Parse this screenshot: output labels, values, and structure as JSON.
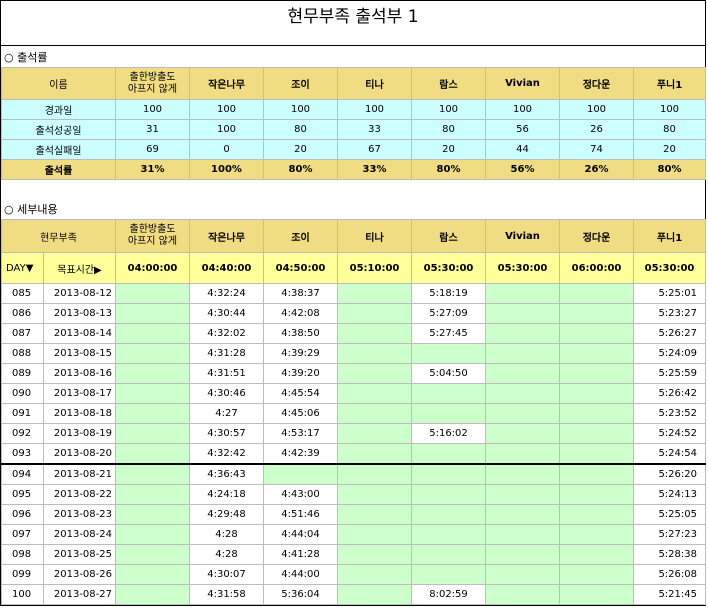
{
  "title": "현무부족 출석부 1",
  "section1": "○ 출석률",
  "section2": "○ 세부내용",
  "members": [
    "출한방출도\n아프지 않게",
    "작은나무",
    "조이",
    "티나",
    "람스",
    "Vivian",
    "정다운",
    "푸니1"
  ],
  "summary": {
    "header_label": "이름",
    "rows": [
      {
        "label": "경과일",
        "values": [
          "100",
          "100",
          "100",
          "100",
          "100",
          "100",
          "100",
          "100"
        ]
      },
      {
        "label": "출석성공일",
        "values": [
          "31",
          "100",
          "80",
          "33",
          "80",
          "56",
          "26",
          "80"
        ]
      },
      {
        "label": "출석실패일",
        "values": [
          "69",
          "0",
          "20",
          "67",
          "20",
          "44",
          "74",
          "20"
        ]
      },
      {
        "label": "출석률",
        "values": [
          "31%",
          "100%",
          "80%",
          "33%",
          "80%",
          "56%",
          "26%",
          "80%"
        ]
      }
    ]
  },
  "detail": {
    "header_label": "현무부족",
    "day_label": "DAY▼",
    "target_label": "목표시간▶",
    "targets": [
      "04:00:00",
      "04:40:00",
      "04:50:00",
      "05:10:00",
      "05:30:00",
      "05:30:00",
      "06:00:00",
      "05:30:00"
    ],
    "rows": [
      {
        "day": "085",
        "date": "2013-08-12",
        "t": [
          "",
          "4:32:24",
          "4:38:37",
          "",
          "5:18:19",
          "",
          "",
          "5:25:01"
        ]
      },
      {
        "day": "086",
        "date": "2013-08-13",
        "t": [
          "",
          "4:30:44",
          "4:42:08",
          "",
          "5:27:09",
          "",
          "",
          "5:23:27"
        ]
      },
      {
        "day": "087",
        "date": "2013-08-14",
        "t": [
          "",
          "4:32:02",
          "4:38:50",
          "",
          "5:27:45",
          "",
          "",
          "5:26:27"
        ]
      },
      {
        "day": "088",
        "date": "2013-08-15",
        "t": [
          "",
          "4:31:28",
          "4:39:29",
          "",
          "",
          "",
          "",
          "5:24:09"
        ]
      },
      {
        "day": "089",
        "date": "2013-08-16",
        "t": [
          "",
          "4:31:51",
          "4:39:20",
          "",
          "5:04:50",
          "",
          "",
          "5:25:59"
        ]
      },
      {
        "day": "090",
        "date": "2013-08-17",
        "t": [
          "",
          "4:30:46",
          "4:45:54",
          "",
          "",
          "",
          "",
          "5:26:42"
        ]
      },
      {
        "day": "091",
        "date": "2013-08-18",
        "t": [
          "",
          "4:27",
          "4:45:06",
          "",
          "",
          "",
          "",
          "5:23:52"
        ]
      },
      {
        "day": "092",
        "date": "2013-08-19",
        "t": [
          "",
          "4:30:57",
          "4:53:17",
          "",
          "5:16:02",
          "",
          "",
          "5:24:52"
        ]
      },
      {
        "day": "093",
        "date": "2013-08-20",
        "t": [
          "",
          "4:32:42",
          "4:42:39",
          "",
          "",
          "",
          "",
          "5:24:54"
        ]
      },
      {
        "day": "094",
        "date": "2013-08-21",
        "t": [
          "",
          "4:36:43",
          "",
          "",
          "",
          "",
          "",
          "5:26:20"
        ]
      },
      {
        "day": "095",
        "date": "2013-08-22",
        "t": [
          "",
          "4:24:18",
          "4:43:00",
          "",
          "",
          "",
          "",
          "5:24:13"
        ]
      },
      {
        "day": "096",
        "date": "2013-08-23",
        "t": [
          "",
          "4:29:48",
          "4:51:46",
          "",
          "",
          "",
          "",
          "5:25:05"
        ]
      },
      {
        "day": "097",
        "date": "2013-08-24",
        "t": [
          "",
          "4:28",
          "4:44:04",
          "",
          "",
          "",
          "",
          "5:27:23"
        ]
      },
      {
        "day": "098",
        "date": "2013-08-25",
        "t": [
          "",
          "4:28",
          "4:41:28",
          "",
          "",
          "",
          "",
          "5:28:38"
        ]
      },
      {
        "day": "099",
        "date": "2013-08-26",
        "t": [
          "",
          "4:30:07",
          "4:44:00",
          "",
          "",
          "",
          "",
          "5:26:08"
        ]
      },
      {
        "day": "100",
        "date": "2013-08-27",
        "t": [
          "",
          "4:31:58",
          "5:36:04",
          "",
          "8:02:59",
          "",
          "",
          "5:21:45"
        ]
      }
    ]
  },
  "colors": {
    "header": "#f0dc82",
    "cyan": "#ccffff",
    "yellow": "#ffff99",
    "green": "#ccffcc"
  }
}
